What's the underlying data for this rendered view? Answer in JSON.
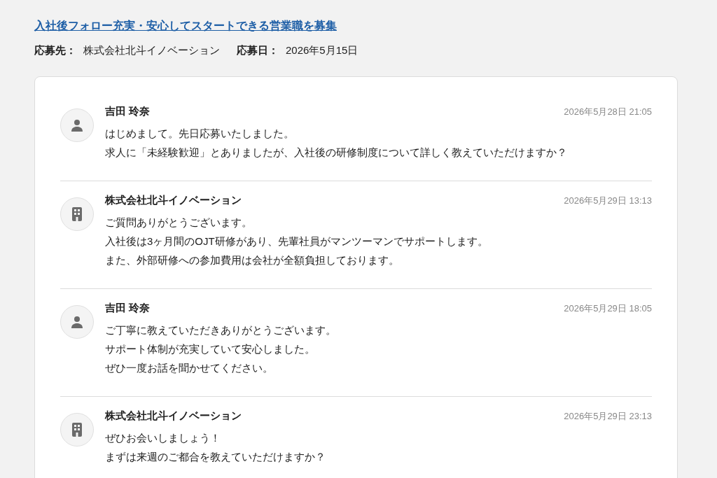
{
  "job": {
    "title": "入社後フォロー充実・安心してスタートできる営業職を募集",
    "meta": [
      {
        "label": "応募先：",
        "value": "株式会社北斗イノベーション"
      },
      {
        "label": "応募日：",
        "value": "2026年5月15日"
      }
    ]
  },
  "messages": [
    {
      "kind": "applicant",
      "sender": "吉田 玲奈",
      "time": "2026年5月28日 21:05",
      "lines": [
        "はじめまして。先日応募いたしました。",
        "求人に「未経験歓迎」とありましたが、入社後の研修制度について詳しく教えていただけますか？"
      ]
    },
    {
      "kind": "company",
      "sender": "株式会社北斗イノベーション",
      "time": "2026年5月29日 13:13",
      "lines": [
        "ご質問ありがとうございます。",
        "入社後は3ヶ月間のOJT研修があり、先輩社員がマンツーマンでサポートします。",
        "また、外部研修への参加費用は会社が全額負担しております。"
      ]
    },
    {
      "kind": "applicant",
      "sender": "吉田 玲奈",
      "time": "2026年5月29日 18:05",
      "lines": [
        "ご丁寧に教えていただきありがとうございます。",
        "サポート体制が充実していて安心しました。",
        "ぜひ一度お話を聞かせてください。"
      ]
    },
    {
      "kind": "company",
      "sender": "株式会社北斗イノベーション",
      "time": "2026年5月29日 23:13",
      "lines": [
        "ぜひお会いしましょう！",
        "まずは来週のご都合を教えていただけますか？"
      ]
    }
  ]
}
